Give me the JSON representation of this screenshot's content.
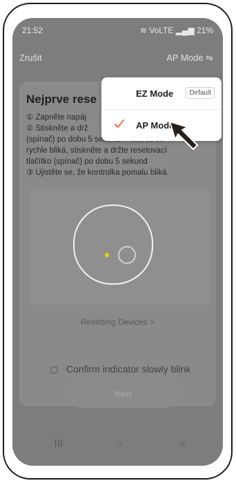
{
  "status": {
    "time": "21:52",
    "right_icons": "≋ VoLTE ▂▄▆ 21%"
  },
  "topbar": {
    "cancel": "Zrušit",
    "mode": "AP Mode ⇋"
  },
  "card": {
    "title": "Nejprve rese",
    "steps": [
      "① Zapněte napáj",
      "② Stiskněte a drž",
      "(spínač) po dobu 5 sekund. Poté, co se",
      "rychle bliká, stiskněte a držte resetovací",
      "tlačítko (spínač) po dobu 5 sekund",
      "③ Ujistěte se, že kontrolka pomalu bliká."
    ]
  },
  "resetting": "Resetting Devices >",
  "confirm": {
    "label": "Confirm indicator slowly blink"
  },
  "next": {
    "label": "Next"
  },
  "dropdown": {
    "ez": {
      "label": "EZ Mode",
      "badge": "Default"
    },
    "ap": {
      "label": "AP Mode"
    },
    "check_color": "#ff6a4d"
  },
  "nav": {
    "menu": "III",
    "home": "○",
    "back": "<"
  }
}
